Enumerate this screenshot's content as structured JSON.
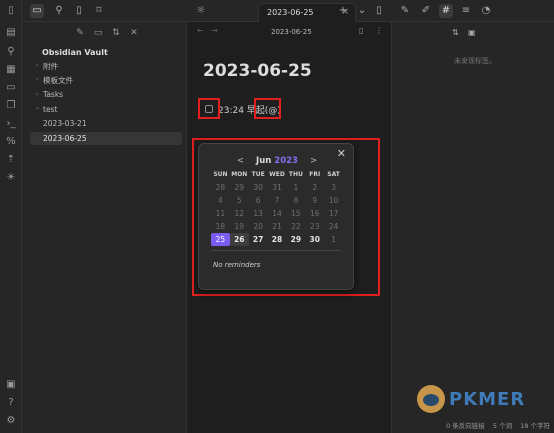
{
  "tab": {
    "title": "2023-06-25",
    "close": "×"
  },
  "explorer": {
    "vault_name": "Obsidian Vault",
    "items": [
      {
        "label": "附件",
        "type": "folder",
        "arrow": "›"
      },
      {
        "label": "模板文件",
        "type": "folder",
        "arrow": "›"
      },
      {
        "label": "Tasks",
        "type": "folder",
        "arrow": "›"
      },
      {
        "label": "test",
        "type": "folder",
        "arrow": "⌄"
      },
      {
        "label": "2023-03-21",
        "type": "file"
      },
      {
        "label": "2023-06-25",
        "type": "file",
        "selected": true
      }
    ]
  },
  "editor": {
    "header_title": "2023-06-25",
    "note_title": "2023-06-25",
    "task_text": "23:24 早起(@)"
  },
  "calendar": {
    "prev": "<",
    "month": "Jun",
    "year": "2023",
    "next": ">",
    "close": "✕",
    "weekdays": [
      "SUN",
      "MON",
      "TUE",
      "WED",
      "THU",
      "FRI",
      "SAT"
    ],
    "weeks": [
      [
        "28",
        "29",
        "30",
        "31",
        "1",
        "2",
        "3"
      ],
      [
        "4",
        "5",
        "6",
        "7",
        "8",
        "9",
        "10"
      ],
      [
        "11",
        "12",
        "13",
        "14",
        "15",
        "16",
        "17"
      ],
      [
        "18",
        "19",
        "20",
        "21",
        "22",
        "23",
        "24"
      ],
      [
        "25",
        "26",
        "27",
        "28",
        "29",
        "30",
        "1"
      ]
    ],
    "reminders": "No reminders"
  },
  "right_panel": {
    "empty": "未发现标签。"
  },
  "branding": {
    "logo_text": "PKMER"
  },
  "status": {
    "backlinks": "0 条反向链接",
    "words": "5 个词",
    "chars": "18 个字符"
  },
  "colors": {
    "accent": "#7b5cf0",
    "annotation": "#e02020",
    "brand": "#3e7bb8"
  }
}
